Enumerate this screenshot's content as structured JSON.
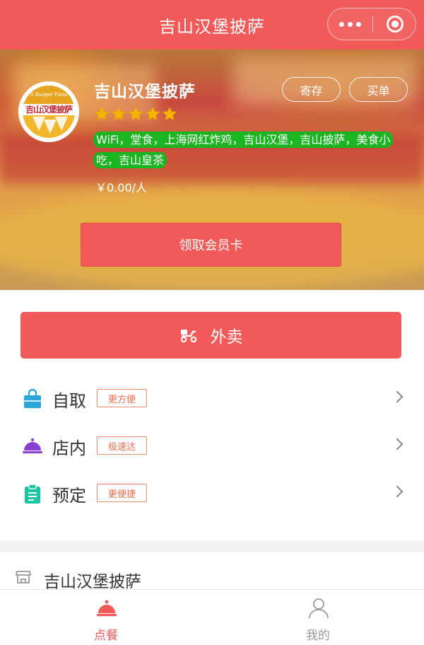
{
  "header": {
    "title": "吉山汉堡披萨",
    "more_icon": "more-dots-icon",
    "close_icon": "close-target-icon"
  },
  "shop": {
    "name": "吉山汉堡披萨",
    "logo_arc_text": "S Burger Pizza",
    "logo_text": "吉山汉堡披萨",
    "rating_stars": 5,
    "store_button": "寄存",
    "bill_button": "买单",
    "tags": "WiFi，堂食，上海网红炸鸡，吉山汉堡，吉山披萨，美食小吃，吉山皇茶",
    "price": "￥0.00/人",
    "member_button": "领取会员卡"
  },
  "services": {
    "takeout_label": "外卖",
    "takeout_icon": "scooter-icon",
    "items": [
      {
        "label": "自取",
        "badge": "更方便",
        "icon": "shopping-bag-icon"
      },
      {
        "label": "店内",
        "badge": "极速达",
        "icon": "food-cloche-icon"
      },
      {
        "label": "预定",
        "badge": "更便捷",
        "icon": "clipboard-icon"
      }
    ]
  },
  "store": {
    "name": "吉山汉堡披萨",
    "icon": "storefront-icon"
  },
  "tabbar": {
    "items": [
      {
        "label": "点餐",
        "icon": "food-cloche-icon",
        "active": true
      },
      {
        "label": "我的",
        "icon": "person-icon",
        "active": false
      }
    ]
  },
  "colors": {
    "primary": "#f25a5a",
    "tag_green": "#1bb522",
    "star_yellow": "#f5b400",
    "bag_blue": "#2aa7d8",
    "cloche_purple": "#8a3fd0",
    "clipboard_teal": "#1ec6a0",
    "badge_orange": "#f06a4a"
  }
}
